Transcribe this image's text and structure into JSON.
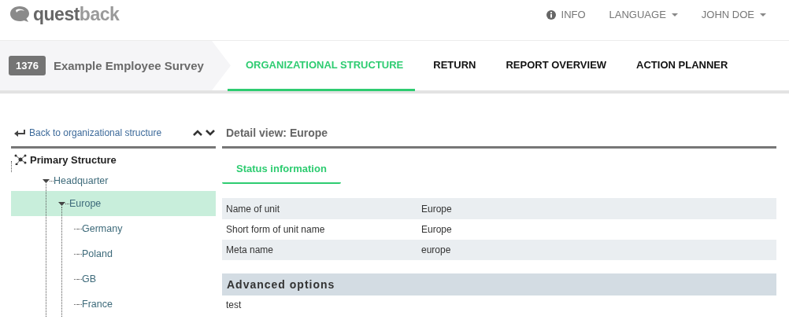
{
  "logo": {
    "parts": [
      "quest",
      "back"
    ]
  },
  "top_menu": [
    {
      "kind": "info",
      "label": "INFO"
    },
    {
      "kind": "dropdown",
      "label": "LANGUAGE"
    },
    {
      "kind": "dropdown",
      "label": "JOHN DOE"
    }
  ],
  "survey": {
    "id": "1376",
    "title": "Example Employee Survey"
  },
  "tabs": [
    {
      "label": "ORGANIZATIONAL STRUCTURE",
      "selected": true
    },
    {
      "label": "RETURN",
      "selected": false
    },
    {
      "label": "REPORT OVERVIEW",
      "selected": false
    },
    {
      "label": "ACTION PLANNER",
      "selected": false
    }
  ],
  "sidebar": {
    "back_link": "Back to organizational structure",
    "tree_root": "Primary Structure",
    "tree": [
      {
        "label": "Headquarter",
        "selected": false,
        "expanded": true,
        "children": [
          {
            "label": "Europe",
            "selected": true,
            "expanded": true,
            "children": [
              {
                "label": "Germany",
                "selected": false,
                "expanded": false
              },
              {
                "label": "Poland",
                "selected": false,
                "expanded": false
              },
              {
                "label": "GB",
                "selected": false,
                "expanded": false
              },
              {
                "label": "France",
                "selected": false,
                "expanded": false
              }
            ]
          }
        ]
      }
    ]
  },
  "detail": {
    "title": "Detail view: Europe",
    "tabs": [
      {
        "label": "Status information",
        "selected": true
      }
    ],
    "rows": [
      {
        "label": "Name of unit",
        "value": "Europe"
      },
      {
        "label": "Short form of unit name",
        "value": "Europe"
      },
      {
        "label": "Meta name",
        "value": "europe"
      }
    ],
    "advanced": {
      "title": "Advanced options",
      "text": "test"
    }
  }
}
